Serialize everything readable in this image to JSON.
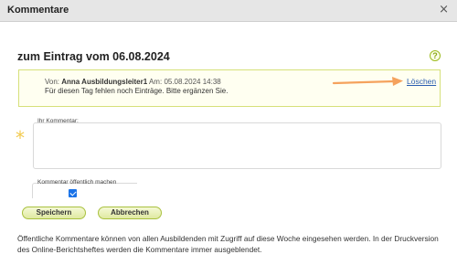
{
  "dialog": {
    "title": "Kommentare",
    "close_glyph": "×"
  },
  "header": {
    "heading": "zum Eintrag vom 06.08.2024",
    "help_glyph": "?"
  },
  "entry": {
    "from_prefix": "Von:",
    "author": "Anna Ausbildungsleiter1",
    "date_prefix": "Am:",
    "date": "05.08.2024 14:38",
    "text": "Für diesen Tag fehlen noch Einträge. Bitte ergänzen Sie.",
    "delete_label": "Löschen"
  },
  "form": {
    "comment_label": "Ihr Kommentar:",
    "comment_value": "",
    "required_marker": "*",
    "public_label": "Kommentar öffentlich machen",
    "public_checked": true,
    "save_label": "Speichern",
    "cancel_label": "Abbrechen"
  },
  "footnote": "Öffentliche Kommentare können von allen Ausbildenden mit Zugriff auf diese Woche eingesehen werden. In der Druckversion des Online-Berichtsheftes werden die Kommentare immer ausgeblendet.",
  "colors": {
    "accent_green": "#a9c13f",
    "arrow_orange": "#f5a25d",
    "required_star": "#f2c94c",
    "link_blue": "#2a5db0"
  }
}
